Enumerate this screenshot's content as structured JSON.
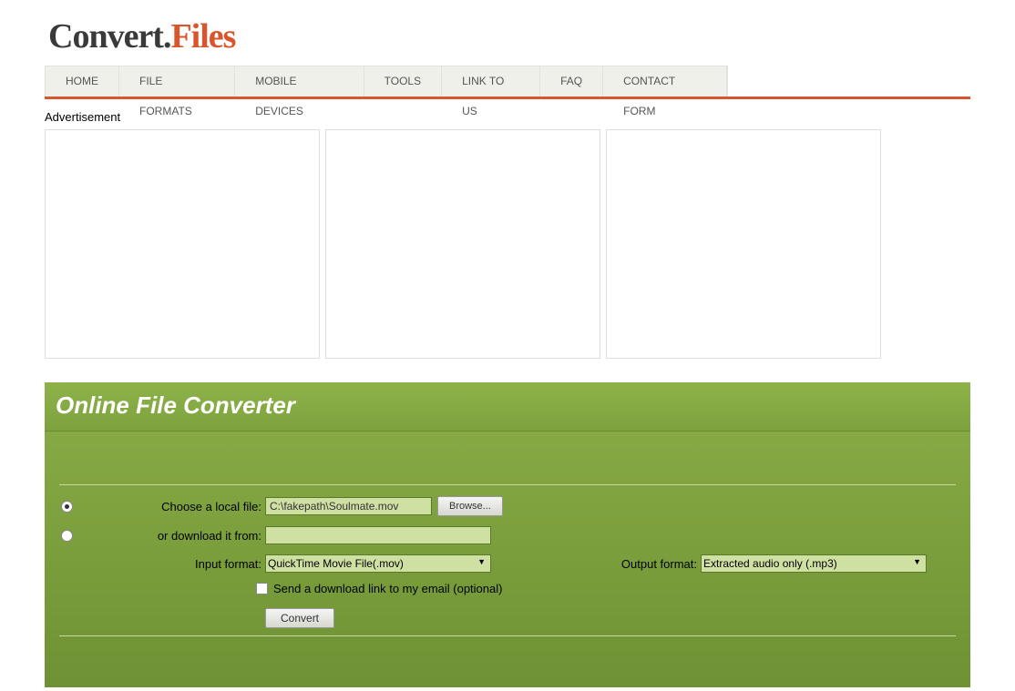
{
  "logo": {
    "part1": "Convert.",
    "part2": "Files"
  },
  "nav": {
    "items": [
      "HOME",
      "FILE FORMATS",
      "MOBILE DEVICES",
      "TOOLS",
      "LINK TO US",
      "FAQ",
      "CONTACT FORM"
    ]
  },
  "ad_label": "Advertisement",
  "converter": {
    "title": "Online File Converter",
    "local_file_label": "Choose a local file:",
    "local_file_value": "C:\\fakepath\\Soulmate.mov",
    "browse_label": "Browse...",
    "download_label": "or download it from:",
    "download_value": "",
    "input_format_label": "Input format:",
    "input_format_value": "QuickTime Movie File(.mov)",
    "output_format_label": "Output format:",
    "output_format_value": "Extracted audio only (.mp3)",
    "email_label": "Send a download link to my email (optional)",
    "convert_label": "Convert"
  }
}
